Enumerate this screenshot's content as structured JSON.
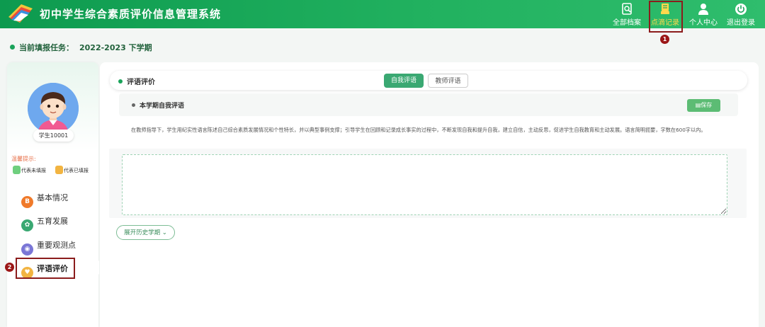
{
  "app": {
    "title": "初中学生综合素质评价信息管理系统"
  },
  "nav": [
    {
      "label": "全部档案",
      "icon": "archive-search-icon",
      "active": false
    },
    {
      "label": "点滴记录",
      "icon": "record-icon",
      "active": true
    },
    {
      "label": "个人中心",
      "icon": "user-icon",
      "active": false
    },
    {
      "label": "退出登录",
      "icon": "power-icon",
      "active": false
    }
  ],
  "annotations": {
    "step1": "1",
    "step2": "2"
  },
  "task": {
    "label": "当前填报任务：",
    "value": "2022-2023 下学期"
  },
  "student": {
    "name": "学生10001"
  },
  "tips": {
    "label": "温馨提示:",
    "legend_unfilled": "代表未填报",
    "legend_filled": "代表已填报"
  },
  "menu": [
    {
      "label": "基本情况",
      "icon": "basic-info-icon",
      "color": "#f07a2a"
    },
    {
      "label": "五育发展",
      "icon": "five-development-icon",
      "color": "#3aa872"
    },
    {
      "label": "重要观测点",
      "icon": "observation-point-icon",
      "color": "#7a76d6"
    },
    {
      "label": "评语评价",
      "icon": "comment-evaluation-icon",
      "color": "#f2b441"
    }
  ],
  "main": {
    "section_title": "评语评价",
    "tabs": [
      "自我评语",
      "教师评语"
    ],
    "sub_title": "本学期自我评语",
    "save_label": "保存",
    "instructions": "在教师指导下，学生用纪实性语言陈述自己综合素质发展情况和个性特长，并以典型事例支撑；引导学生在回顾和记录成长事实的过程中，不断发现自我和提升自我，建立自信，主动反思，促进学生自我教育和主动发展。语言简明扼要，字数在600字以内。",
    "textarea_value": "",
    "expand_label": "展开历史学期"
  },
  "colors": {
    "brand": "#1aa35a",
    "accent": "#3aa872",
    "highlight": "#ffd84d",
    "annotation": "#9b1616"
  }
}
